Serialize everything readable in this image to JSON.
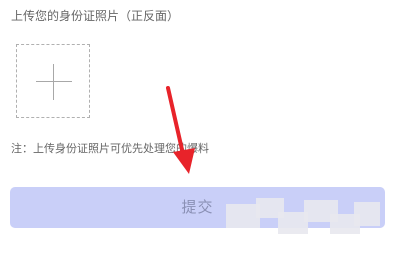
{
  "form": {
    "upload_label": "上传您的身份证照片（正反面）",
    "note": "注：上传身份证照片可优先处理您的爆料",
    "submit_label": "提交"
  },
  "icons": {
    "upload": "plus-icon",
    "annotation": "red-arrow-icon"
  },
  "colors": {
    "button_bg": "#c9cff8",
    "button_text": "#8a90b4",
    "arrow": "#e8232a"
  }
}
